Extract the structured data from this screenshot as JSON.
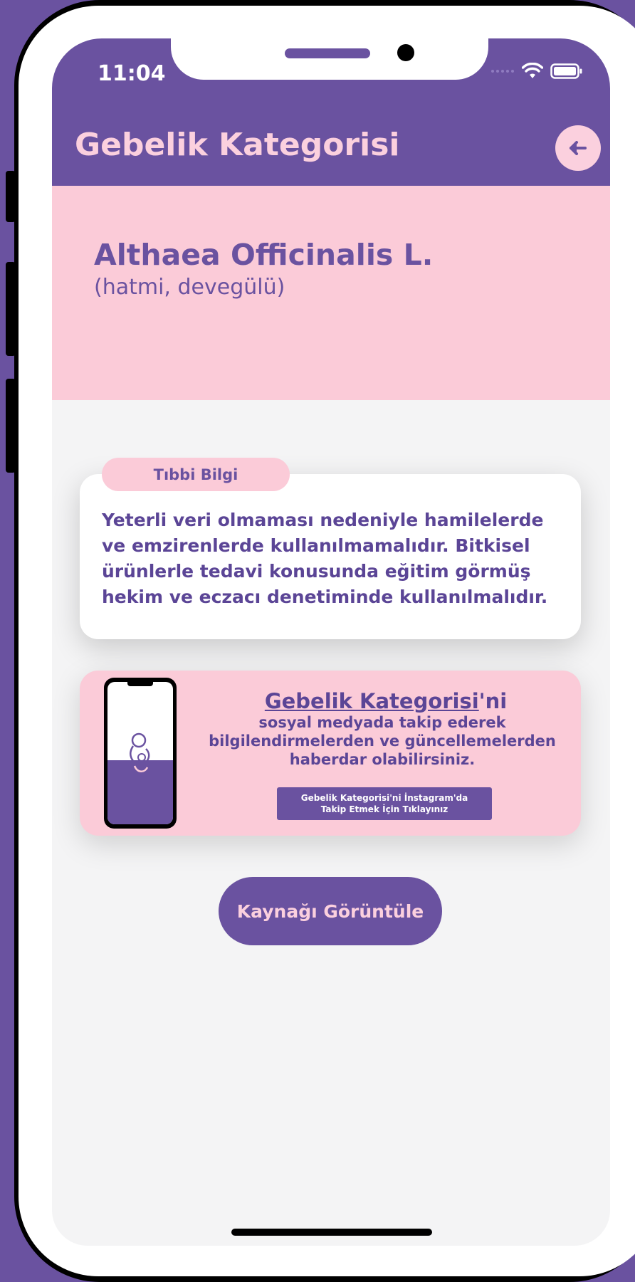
{
  "status_bar": {
    "time": "11:04",
    "icons": [
      "signal-dots-icon",
      "wifi-icon",
      "battery-icon"
    ]
  },
  "app_bar": {
    "title": "Gebelik Kategorisi",
    "back_icon": "arrow-left-icon"
  },
  "hero": {
    "plant_name": "Althaea Officinalis L.",
    "common_name": "(hatmi, devegülü)"
  },
  "info_card": {
    "tab_label": "Tıbbi Bilgi",
    "text": "Yeterli veri olmaması nedeniyle hamilelerde ve emzirenlerde kullanılmamalıdır. Bitkisel ürünlerle tedavi konusunda eğitim görmüş hekim ve eczacı denetiminde kullanılmalıdır."
  },
  "promo": {
    "title_underlined": "Gebelik Kategorisi",
    "title_suffix": "'ni",
    "body": "sosyal medyada takip ederek bilgilendirmelerden ve güncellemelerden haberdar olabilirsiniz.",
    "button_label": "Gebelik Kategorisi'ni İnstagram'da\nTakip Etmek İçin Tıklayınız"
  },
  "source_button": {
    "label": "Kaynağı Görüntüle"
  },
  "colors": {
    "primary": "#6a52a0",
    "pink": "#fbcbd8",
    "background": "#f4f4f5"
  }
}
